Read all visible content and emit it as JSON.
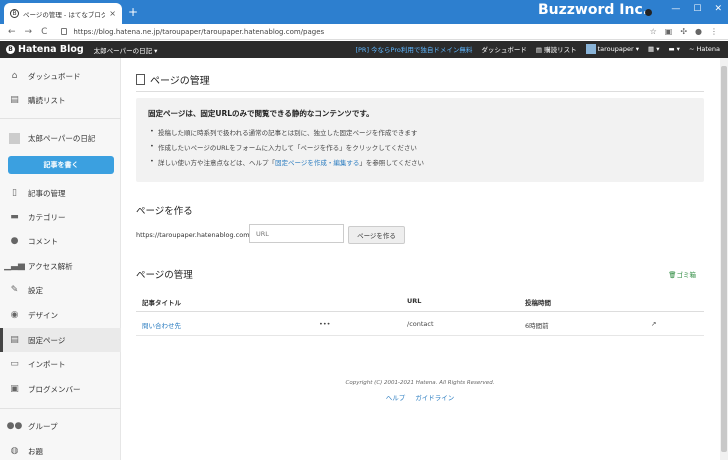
{
  "browser": {
    "tab_title": "ページの管理 - はてなブログ",
    "tab_close": "×",
    "new_tab": "+",
    "brand": "Buzzword Inc.",
    "url": "https://blog.hatena.ne.jp/taroupaper/taroupaper.hatenablog.com/pages",
    "nav": {
      "back": "←",
      "forward": "→",
      "reload": "C"
    }
  },
  "header": {
    "logo": "Hatena Blog",
    "blog_selector": "太郎ペーパーの日記 ▾",
    "pro_promo": "[PR] 今ならPro利用で独自ドメイン無料",
    "dashboard": "ダッシュボード",
    "subscriptions": "購読リスト",
    "user": "taroupaper ▾",
    "hatena": "Hatena"
  },
  "sidebar": {
    "items": [
      {
        "label": "ダッシュボード",
        "icon": "home-icon"
      },
      {
        "label": "購読リスト",
        "icon": "inbox-icon"
      },
      {
        "label": "太郎ペーパーの日記",
        "icon": "blog-icon"
      },
      {
        "label": "記事の管理",
        "icon": "document-icon"
      },
      {
        "label": "カテゴリー",
        "icon": "folder-icon"
      },
      {
        "label": "コメント",
        "icon": "comment-icon"
      },
      {
        "label": "アクセス解析",
        "icon": "bar-chart-icon"
      },
      {
        "label": "設定",
        "icon": "wrench-icon"
      },
      {
        "label": "デザイン",
        "icon": "palette-icon"
      },
      {
        "label": "固定ページ",
        "icon": "page-icon"
      },
      {
        "label": "インポート",
        "icon": "import-icon"
      },
      {
        "label": "ブログメンバー",
        "icon": "member-icon"
      },
      {
        "label": "グループ",
        "icon": "group-icon"
      },
      {
        "label": "お題",
        "icon": "topic-icon"
      }
    ],
    "write_button": "記事を書く"
  },
  "main": {
    "title": "ページの管理",
    "info": {
      "lead": "固定ページは、固定URLのみで閲覧できる静的なコンテンツです。",
      "bullets": [
        "投稿した順に時系列で扱われる通常の記事とは別に、独立した固定ページを作成できます",
        "作成したいページのURLをフォームに入力して「ページを作る」をクリックしてください"
      ],
      "bullet3_before": "詳しい使い方や注意点などは、ヘルプ「",
      "bullet3_link": "固定ページを作成・編集する",
      "bullet3_after": "」を参照してください"
    },
    "create": {
      "title": "ページを作る",
      "prefix": "https://taroupaper.hatenablog.com/",
      "placeholder": "URL",
      "button": "ページを作る"
    },
    "manage": {
      "title": "ページの管理",
      "trash": "ゴミ箱",
      "columns": [
        "記事タイトル",
        "URL",
        "投稿時間"
      ],
      "rows": [
        {
          "title": "問い合わせ先",
          "more": "•••",
          "url": "/contact",
          "time": "6時間前"
        }
      ]
    },
    "footer": {
      "copyright": "Copyright (C) 2001-2021 Hatena. All Rights Reserved.",
      "help": "ヘルプ",
      "guideline": "ガイドライン"
    }
  }
}
